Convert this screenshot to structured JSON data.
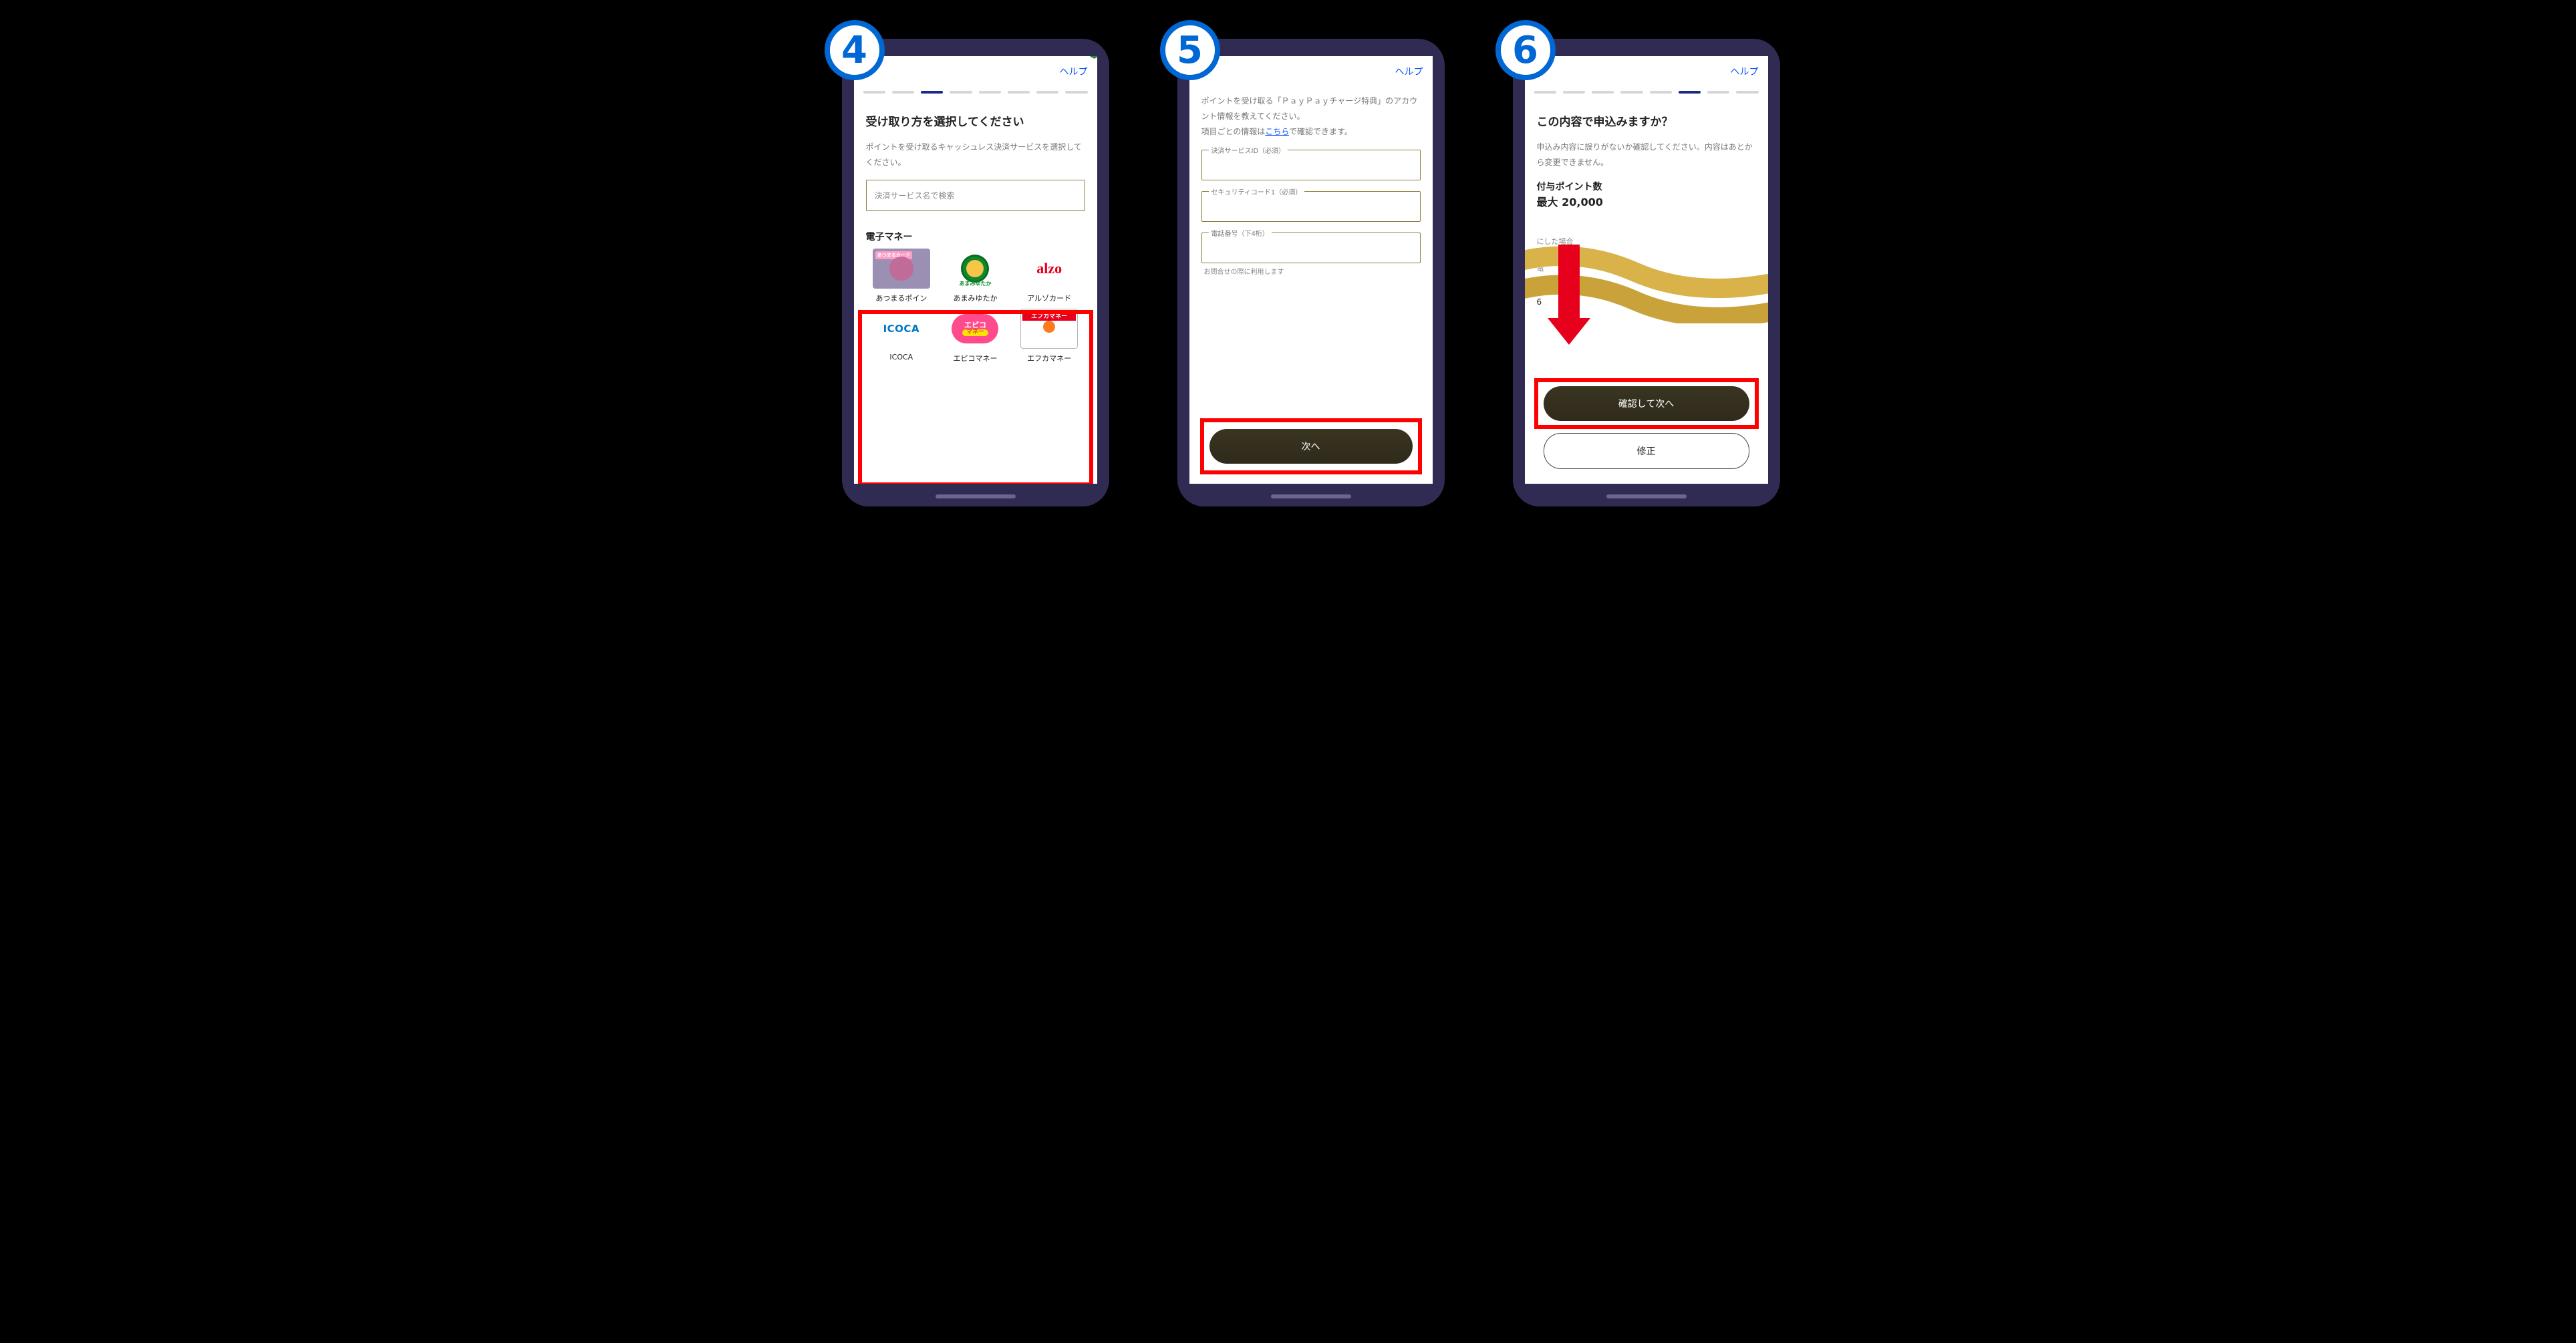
{
  "nav": {
    "help_label": "ヘルプ"
  },
  "step4": {
    "badge": "4",
    "progress_active_index": 2,
    "title": "受け取り方を選択してください",
    "subtitle": "ポイントを受け取るキャッシュレス決済サービスを選択してください。",
    "search_placeholder": "決済サービス名で検索",
    "section_emoney": "電子マネー",
    "options": [
      {
        "tile_tag": "あつまるカード",
        "label": "あつまるポイン"
      },
      {
        "tile_sub": "あまみゆたか",
        "label": "あまみゆたか"
      },
      {
        "tile_text": "alzo",
        "label": "アルゾカード"
      },
      {
        "tile_text": "ICOCA",
        "label": "ICOCA"
      },
      {
        "tile_top": "エピコ",
        "tile_bot": "マネー",
        "label": "エピコマネー"
      },
      {
        "tile_band": "エフカマネー",
        "label": "エフカマネー"
      }
    ]
  },
  "step5": {
    "badge": "5",
    "desc_a": "ポイントを受け取る「ＰａｙＰａｙチャージ特典」のアカウント情報を教えてください。",
    "desc_b_prefix": "項目ごとの情報は",
    "desc_b_link": "こちら",
    "desc_b_suffix": "で確認できます。",
    "fields": {
      "service_id": "決済サービスID（必須）",
      "security_code": "セキュリティコード1（必須）",
      "phone4": "電話番号（下4桁）"
    },
    "phone_hint": "お問合せの際に利用します",
    "next_label": "次へ"
  },
  "step6": {
    "badge": "6",
    "progress_active_index": 5,
    "title": "この内容で申込みますか？",
    "subtitle": "申込み内容に誤りがないか確認してください。内容はあとから変更できません。",
    "section_points": "付与ポイント数",
    "max_line_prefix": "最大",
    "max_line_value": "20,000",
    "detail_fragment_a": "にした場合",
    "detail_fragment_b": "電",
    "detail_fragment_c": "6",
    "confirm_label": "確認して次へ",
    "edit_label": "修正"
  }
}
